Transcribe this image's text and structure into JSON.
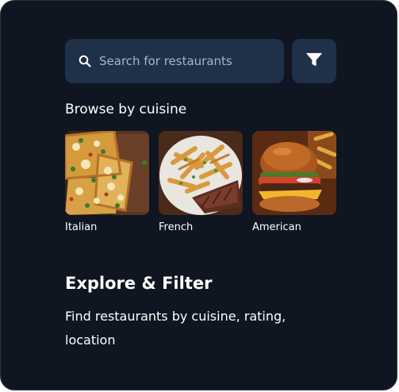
{
  "search": {
    "placeholder": "Search for restaurants",
    "value": ""
  },
  "icons": {
    "search": "search-icon",
    "filter": "filter-funnel-icon"
  },
  "browse": {
    "heading": "Browse by cuisine",
    "cuisines": [
      {
        "label": "Italian",
        "image": "pizza-photo"
      },
      {
        "label": "French",
        "image": "steak-frites-photo"
      },
      {
        "label": "American",
        "image": "burger-photo"
      }
    ]
  },
  "explore": {
    "title": "Explore & Filter",
    "description": "Find restaurants by cuisine, rating, location"
  },
  "colors": {
    "background": "#0f1521",
    "control": "#1f3049",
    "text": "#ffffff",
    "muted_text": "#a9b4c6"
  }
}
